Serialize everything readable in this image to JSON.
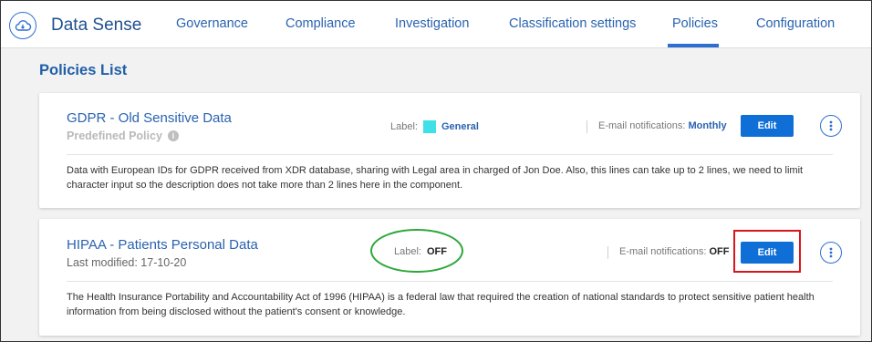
{
  "app": {
    "title": "Data Sense"
  },
  "nav": {
    "items": [
      "Governance",
      "Compliance",
      "Investigation",
      "Classification settings",
      "Policies",
      "Configuration"
    ],
    "active": "Policies"
  },
  "page": {
    "title": "Policies List"
  },
  "policies": [
    {
      "name": "GDPR - Old Sensitive Data",
      "subtitle": "Predefined Policy",
      "label_caption": "Label:",
      "label_value": "General",
      "label_color": "#3fe0e6",
      "email_caption": "E-mail notifications:",
      "email_value": "Monthly",
      "edit_label": "Edit",
      "description": "Data with European IDs for GDPR received from XDR database, sharing with Legal area in charged of Jon Doe. Also, this lines can take up to 2 lines, we need to limit character input so the description does not take more than 2 lines here in the component."
    },
    {
      "name": "HIPAA - Patients Personal Data",
      "subtitle": "Last modified: 17-10-20",
      "label_caption": "Label:",
      "label_value": "OFF",
      "email_caption": "E-mail notifications:",
      "email_value": "OFF",
      "edit_label": "Edit",
      "description": "The Health Insurance Portability and Accountability Act of 1996 (HIPAA) is a federal law that required the creation of national standards to protect sensitive patient health information from being disclosed without the patient's consent or knowledge."
    }
  ],
  "colors": {
    "accent": "#2d6fd0",
    "button": "#0f6fd6",
    "highlight_box": "#d8161b",
    "highlight_ellipse": "#2ea83a"
  }
}
